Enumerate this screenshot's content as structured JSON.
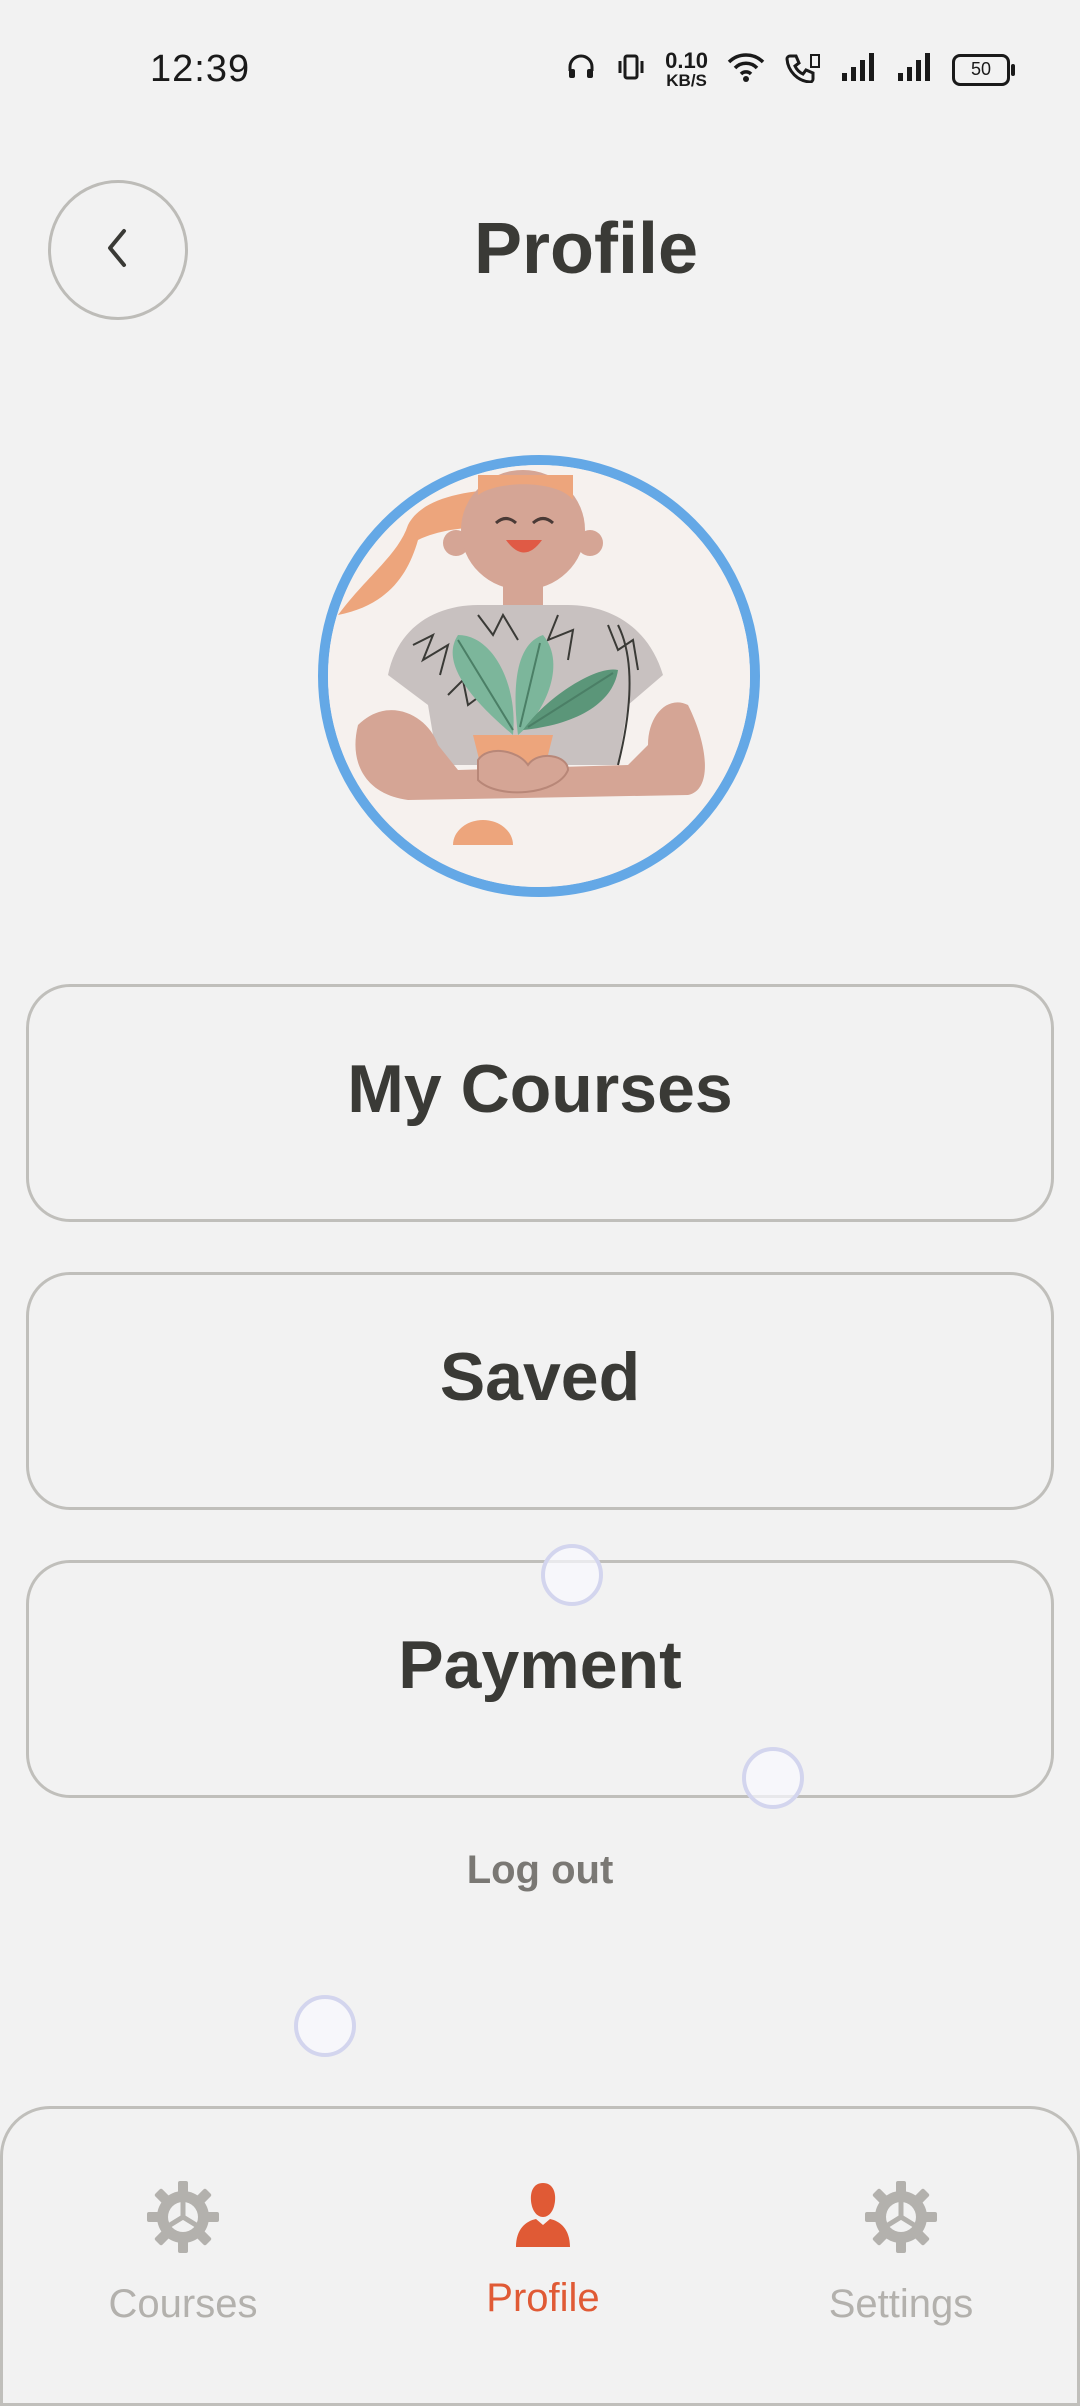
{
  "status_bar": {
    "time": "12:39",
    "net_speed_value": "0.10",
    "net_speed_unit": "KB/S",
    "battery": "50",
    "icons": [
      "headphones-icon",
      "vibrate-icon",
      "wifi-icon",
      "call-icon",
      "signal-icon",
      "signal-icon",
      "battery-icon"
    ]
  },
  "header": {
    "title": "Profile",
    "back_icon": "chevron-left-icon"
  },
  "avatar": {
    "ring_color": "#64a8e6"
  },
  "menu": {
    "my_courses": "My Courses",
    "saved": "Saved",
    "payment": "Payment",
    "logout": "Log out"
  },
  "bottom_nav": {
    "items": [
      {
        "label": "Courses",
        "icon": "gear-icon",
        "active": false
      },
      {
        "label": "Profile",
        "icon": "person-icon",
        "active": true
      },
      {
        "label": "Settings",
        "icon": "gear-icon",
        "active": false
      }
    ],
    "active_color": "#e05a35",
    "inactive_color": "#b3b1ad"
  }
}
